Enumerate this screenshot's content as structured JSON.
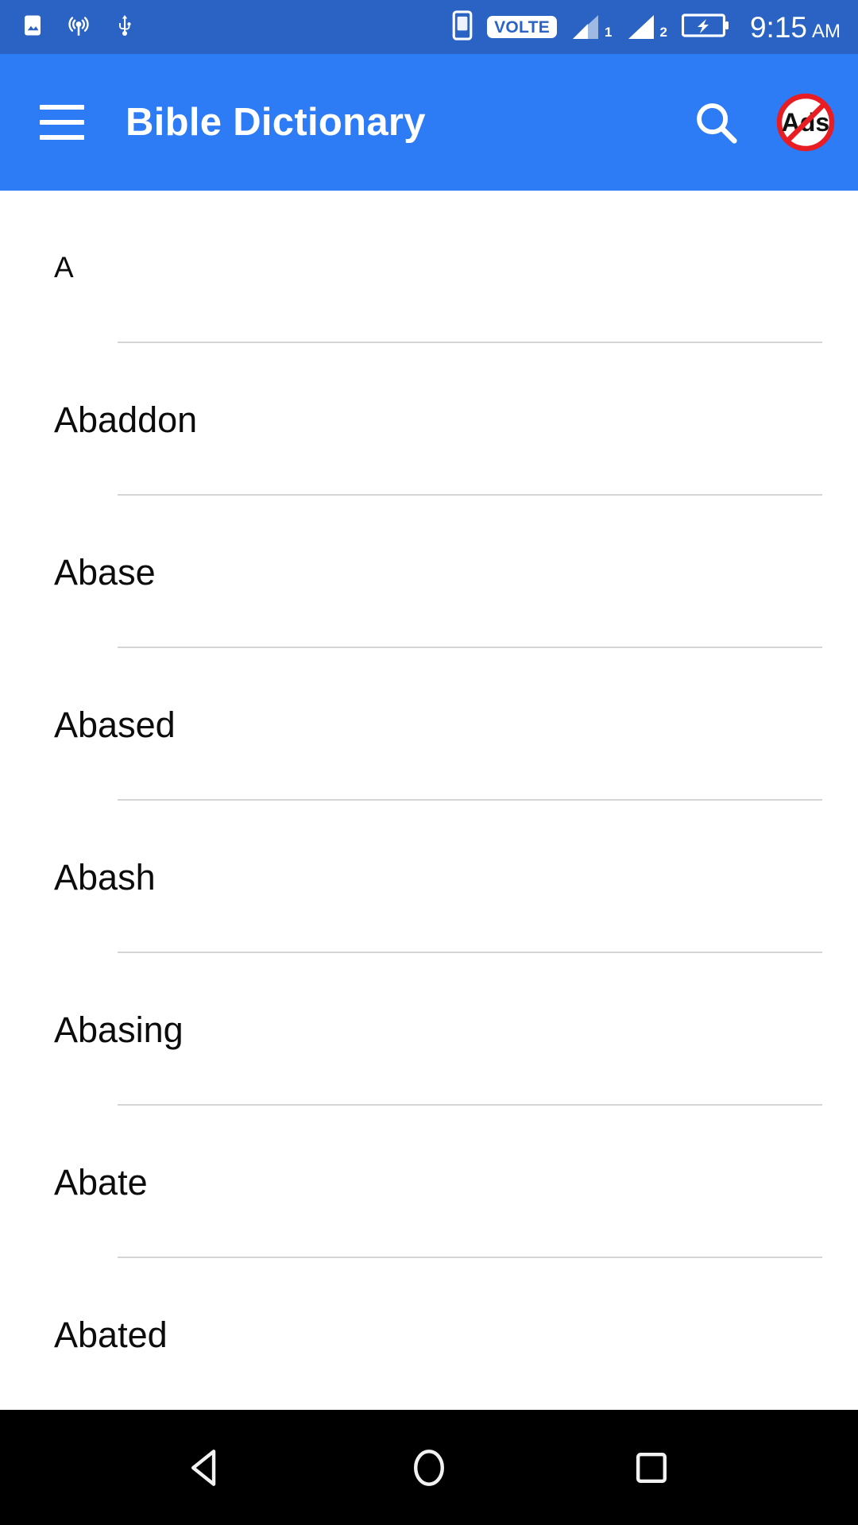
{
  "status_bar": {
    "background_color": "#2A63C4",
    "left_icons": [
      {
        "name": "image-icon",
        "label": "Screenshot"
      },
      {
        "name": "hotspot-icon",
        "label": "Hotspot"
      },
      {
        "name": "usb-icon",
        "label": "USB"
      }
    ],
    "right_icons": [
      {
        "name": "sim-card-icon",
        "label": "SIM"
      },
      {
        "name": "volte-icon",
        "label": "VOLTE"
      },
      {
        "name": "signal-icon-1",
        "label": "1"
      },
      {
        "name": "signal-icon-2",
        "label": "2"
      },
      {
        "name": "battery-charging-icon",
        "label": "Charging"
      }
    ],
    "volte_label": "VOLTE",
    "sim1_label": "1",
    "sim2_label": "2",
    "time": "9:15",
    "time_period": "AM"
  },
  "app_bar": {
    "background_color": "#2E7BF6",
    "title": "Bible Dictionary",
    "menu_label": "Open navigation drawer",
    "search_label": "Search",
    "no_ads_label": "Ads",
    "no_ads_tooltip": "Remove Ads"
  },
  "list": {
    "items": [
      {
        "label": "A",
        "is_header": true
      },
      {
        "label": "Abaddon",
        "is_header": false
      },
      {
        "label": "Abase",
        "is_header": false
      },
      {
        "label": "Abased",
        "is_header": false
      },
      {
        "label": "Abash",
        "is_header": false
      },
      {
        "label": "Abasing",
        "is_header": false
      },
      {
        "label": "Abate",
        "is_header": false
      },
      {
        "label": "Abated",
        "is_header": false
      }
    ]
  },
  "nav_bar": {
    "background_color": "#000000",
    "buttons": [
      {
        "name": "back-button",
        "label": "Back"
      },
      {
        "name": "home-button",
        "label": "Home"
      },
      {
        "name": "recents-button",
        "label": "Recent apps"
      }
    ]
  },
  "colors": {
    "status_bar": "#2A63C4",
    "app_bar": "#2E7BF6",
    "divider": "#d5d5d5",
    "text_primary": "#0c0c0c",
    "no_ads_red": "#E81C23"
  }
}
